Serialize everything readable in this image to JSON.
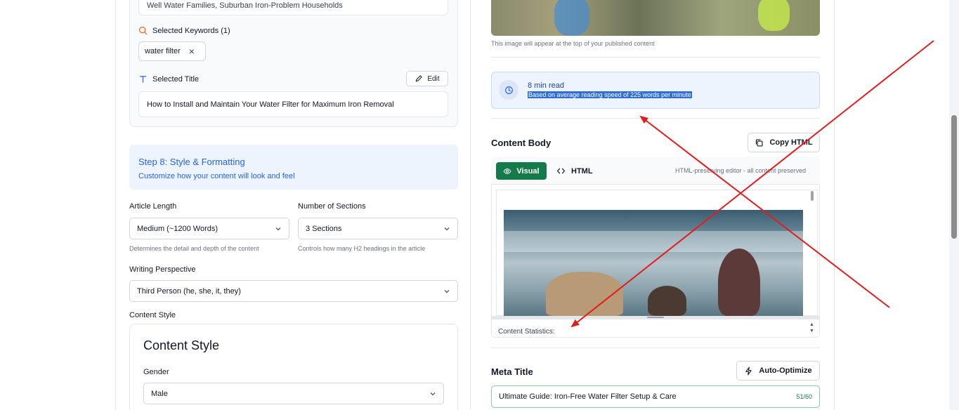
{
  "left": {
    "audience_value": "Well Water Families, Suburban Iron-Problem Households",
    "keywords_label": "Selected Keywords (1)",
    "keyword_chip": "water filter",
    "keyword_remove": "×",
    "title_label": "Selected Title",
    "edit_label": "Edit",
    "title_value": "How to Install and Maintain Your Water Filter for Maximum Iron Removal",
    "step_title": "Step 8: Style & Formatting",
    "step_subtitle": "Customize how your content will look and feel",
    "article_length_label": "Article Length",
    "article_length_value": "Medium (~1200 Words)",
    "article_length_hint": "Determines the detail and depth of the content",
    "sections_label": "Number of Sections",
    "sections_value": "3 Sections",
    "sections_hint": "Controls how many H2 headings in the article",
    "perspective_label": "Writing Perspective",
    "perspective_value": "Third Person (he, she, it, they)",
    "content_style_label": "Content Style",
    "content_style_heading": "Content Style",
    "gender_label": "Gender",
    "gender_value": "Male"
  },
  "right": {
    "image_caption": "This image will appear at the top of your published content",
    "read_time": "8 min read",
    "read_note": "Based on average reading speed of 225 words per minute",
    "content_body_heading": "Content Body",
    "copy_html_label": "Copy HTML",
    "visual_tab": "Visual",
    "html_tab": "HTML",
    "editor_note": "HTML-preserving editor - all content preserved",
    "content_stats_label": "Content Statistics:",
    "meta_title_heading": "Meta Title",
    "auto_optimize_label": "Auto-Optimize",
    "meta_title_value": "Ultimate Guide: Iron-Free Water Filter Setup & Care",
    "meta_title_count": "51/60"
  },
  "icons": {
    "keywords": "search-icon",
    "title": "text-icon",
    "edit": "pencil-icon",
    "read": "clock-icon",
    "copy": "copy-icon",
    "visual": "eye-icon",
    "html": "code-icon",
    "auto_optimize": "bolt-icon",
    "select": "chevron-down-icon"
  },
  "colors": {
    "accent_blue": "#2563eb",
    "visual_green": "#157a4a",
    "keyword_icon_orange": "#ea6a1f",
    "annotation_red": "#e11d1d",
    "meta_border_green": "#86d0a4"
  }
}
